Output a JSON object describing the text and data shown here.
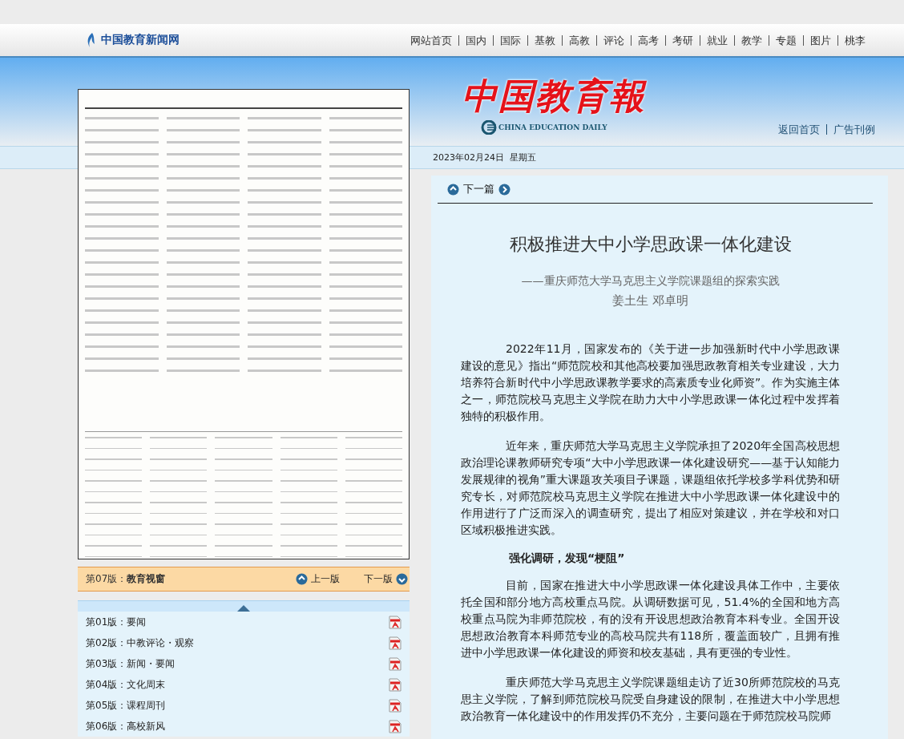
{
  "site_logo": "中国教育新闻网",
  "nav": [
    "网站首页",
    "国内",
    "国际",
    "基教",
    "高教",
    "评论",
    "高考",
    "考研",
    "就业",
    "教学",
    "专题",
    "图片",
    "桃李"
  ],
  "masthead": {
    "title": "中国教育報",
    "subtitle": "CHINA EDUCATION DAILY",
    "links": [
      "返回首页",
      "广告刊例"
    ]
  },
  "date": "2023年02月24日  星期五",
  "edition_bar": {
    "label": "第07版：",
    "name": "教育视窗",
    "prev": "上一版",
    "next": "下一版"
  },
  "editions": [
    {
      "label": "第01版：",
      "name": "要闻"
    },
    {
      "label": "第02版：",
      "name": "中教评论・观察"
    },
    {
      "label": "第03版：",
      "name": "新闻・要闻"
    },
    {
      "label": "第04版：",
      "name": "文化周末"
    },
    {
      "label": "第05版：",
      "name": "课程周刊"
    },
    {
      "label": "第06版：",
      "name": "高校新风"
    }
  ],
  "article": {
    "next_link": "下一篇",
    "title": "积极推进大中小学思政课一体化建设",
    "subtitle": "——重庆师范大学马克思主义学院课题组的探索实践",
    "authors": "姜土生  邓卓明",
    "blocks": [
      {
        "kind": "paragraph",
        "text": "2022年11月，国家发布的《关于进一步加强新时代中小学思政课建设的意见》指出“师范院校和其他高校要加强思政教育相关专业建设，大力培养符合新时代中小学思政课教学要求的高素质专业化师资”。作为实施主体之一，师范院校马克思主义学院在助力大中小学思政课一体化过程中发挥着独特的积极作用。"
      },
      {
        "kind": "paragraph",
        "text": "近年来，重庆师范大学马克思主义学院承担了2020年全国高校思想政治理论课教师研究专项“大中小学思政课一体化建设研究——基于认知能力发展规律的视角”重大课题攻关项目子课题，课题组依托学校多学科优势和研究专长，对师范院校马克思主义学院在推进大中小学思政课一体化建设中的作用进行了广泛而深入的调查研究，提出了相应对策建议，并在学校和对口区域积极推进实践。"
      },
      {
        "kind": "heading",
        "text": "强化调研，发现“梗阻”"
      },
      {
        "kind": "paragraph",
        "text": "目前，国家在推进大中小学思政课一体化建设具体工作中，主要依托全国和部分地方高校重点马院。从调研数据可见，51.4%的全国和地方高校重点马院为非师范院校，有的没有开设思想政治教育本科专业。全国开设思想政治教育本科师范专业的高校马院共有118所，覆盖面较广，且拥有推进中小学思政课一体化建设的师资和校友基础，具有更强的专业性。"
      },
      {
        "kind": "paragraph",
        "text": "重庆师范大学马克思主义学院课题组走访了近30所师范院校的马克思主义学院，了解到师范院校马院受自身建设的限制，在推进大中小学思想政治教育一体化建设中的作用发挥仍不充分，主要问题在于师范院校马院师"
      }
    ]
  }
}
